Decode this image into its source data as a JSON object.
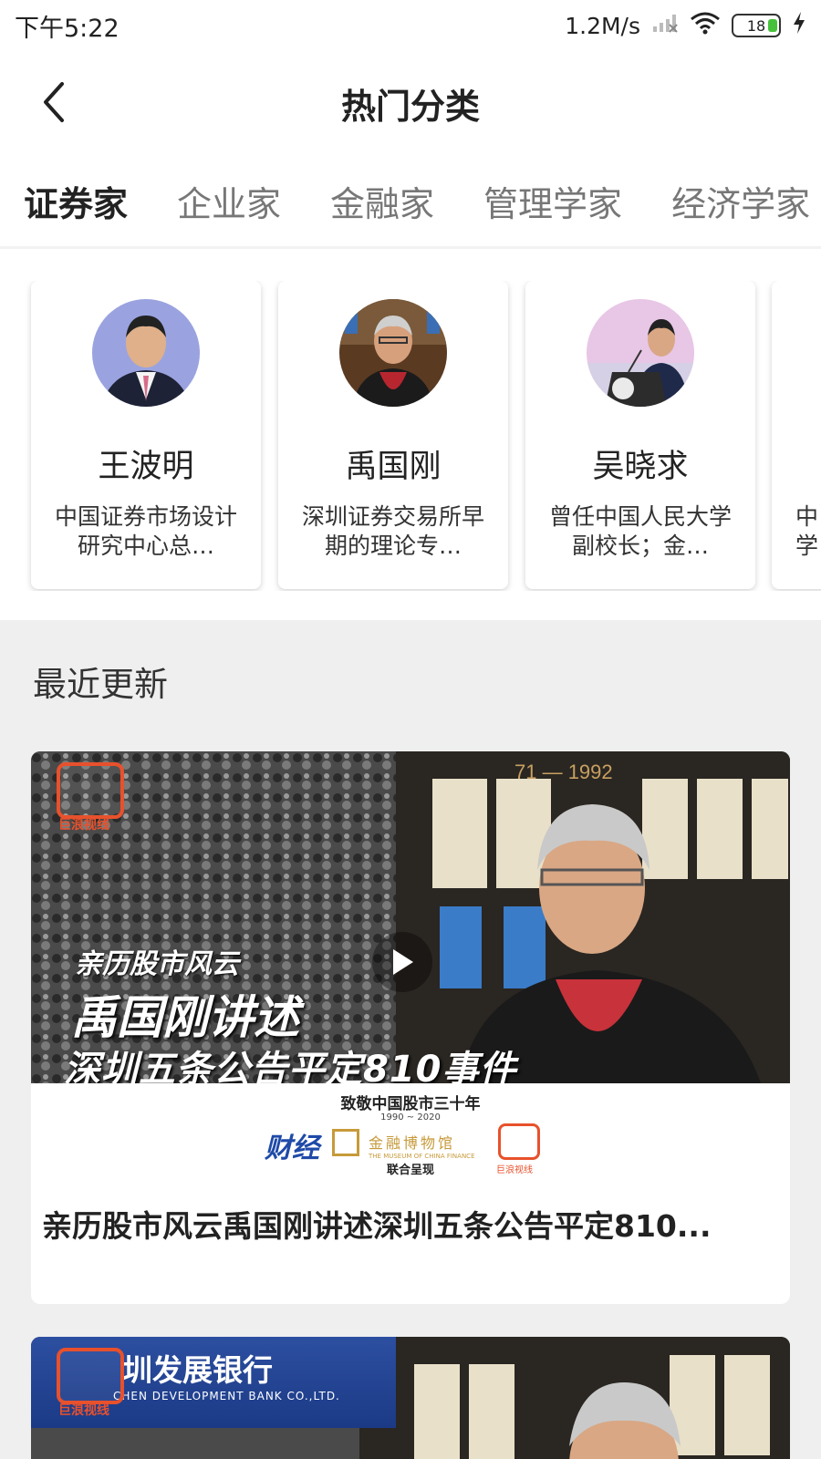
{
  "status": {
    "time": "下午5:22",
    "speed": "1.2M/s",
    "battery": "18",
    "battery_level": 0.18
  },
  "header": {
    "back_icon": "chevron-left-icon",
    "title": "热门分类"
  },
  "tabs": [
    {
      "label": "证券家",
      "active": true
    },
    {
      "label": "企业家",
      "active": false
    },
    {
      "label": "金融家",
      "active": false
    },
    {
      "label": "管理学家",
      "active": false
    },
    {
      "label": "经济学家",
      "active": false
    }
  ],
  "experts": [
    {
      "name": "王波明",
      "desc": "中国证券市场设计研究中心总…"
    },
    {
      "name": "禹国刚",
      "desc": "深圳证券交易所早期的理论专…"
    },
    {
      "name": "吴晓求",
      "desc": "曾任中国人民大学副校长；金…"
    },
    {
      "name": "",
      "desc": "中学"
    }
  ],
  "recent": {
    "section_title": "最近更新",
    "videos": [
      {
        "overlay_line1": "亲历股市风云",
        "overlay_line2": "禹国刚讲述",
        "overlay_line3": "深圳五条公告平定810事件",
        "logo_text": "巨浪视线",
        "band_title": "致敬中国股市三十年",
        "band_years": "1990 ~ 2020",
        "band_brand": "财经",
        "band_museum": "金融博物馆",
        "band_museum_en": "THE MUSEUM OF CHINA FINANCE",
        "band_joint": "联合呈现",
        "band_logo_text": "巨浪视线",
        "title": "亲历股市风云禹国刚讲述深圳五条公告平定810..."
      },
      {
        "bank_name": "圳发展银行",
        "bank_name_en": "CHEN DEVELOPMENT BANK CO.,LTD.",
        "logo_text": "巨浪视线"
      }
    ]
  },
  "colors": {
    "accent": "#e8512c",
    "background_section": "#efefef",
    "battery_green": "#46c13b"
  }
}
